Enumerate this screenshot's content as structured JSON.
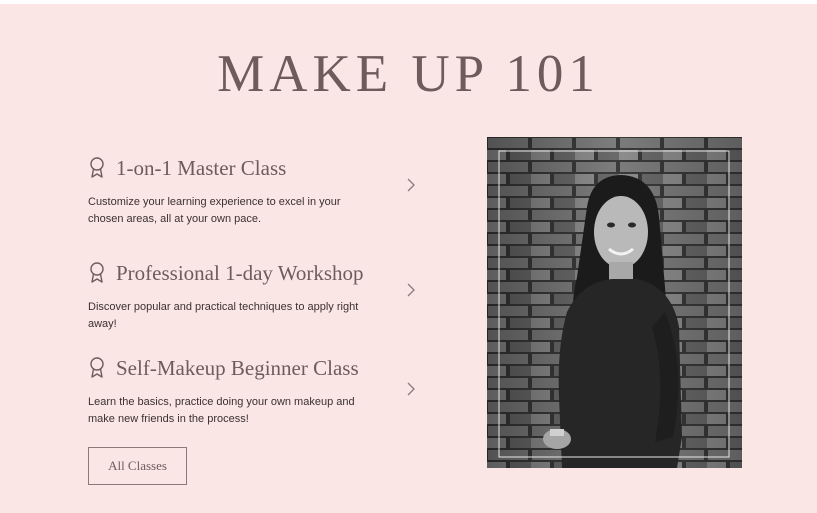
{
  "page": {
    "title": "MAKE UP 101"
  },
  "classes": [
    {
      "name": "1-on-1 Master Class",
      "description": "Customize your learning experience to excel in your chosen areas, all at your own pace."
    },
    {
      "name": "Professional 1-day Workshop",
      "description": "Discover popular and practical techniques to apply right away!"
    },
    {
      "name": "Self-Makeup Beginner Class",
      "description": "Learn the basics, practice doing your own makeup and make new friends in the process!"
    }
  ],
  "cta": {
    "label": "All Classes"
  },
  "colors": {
    "background": "#fbe6e6",
    "heading": "#6e5c5c",
    "body_text": "#3b3030"
  },
  "icons": {
    "class_icon": "award-ribbon-icon",
    "arrow_icon": "chevron-right-icon"
  }
}
